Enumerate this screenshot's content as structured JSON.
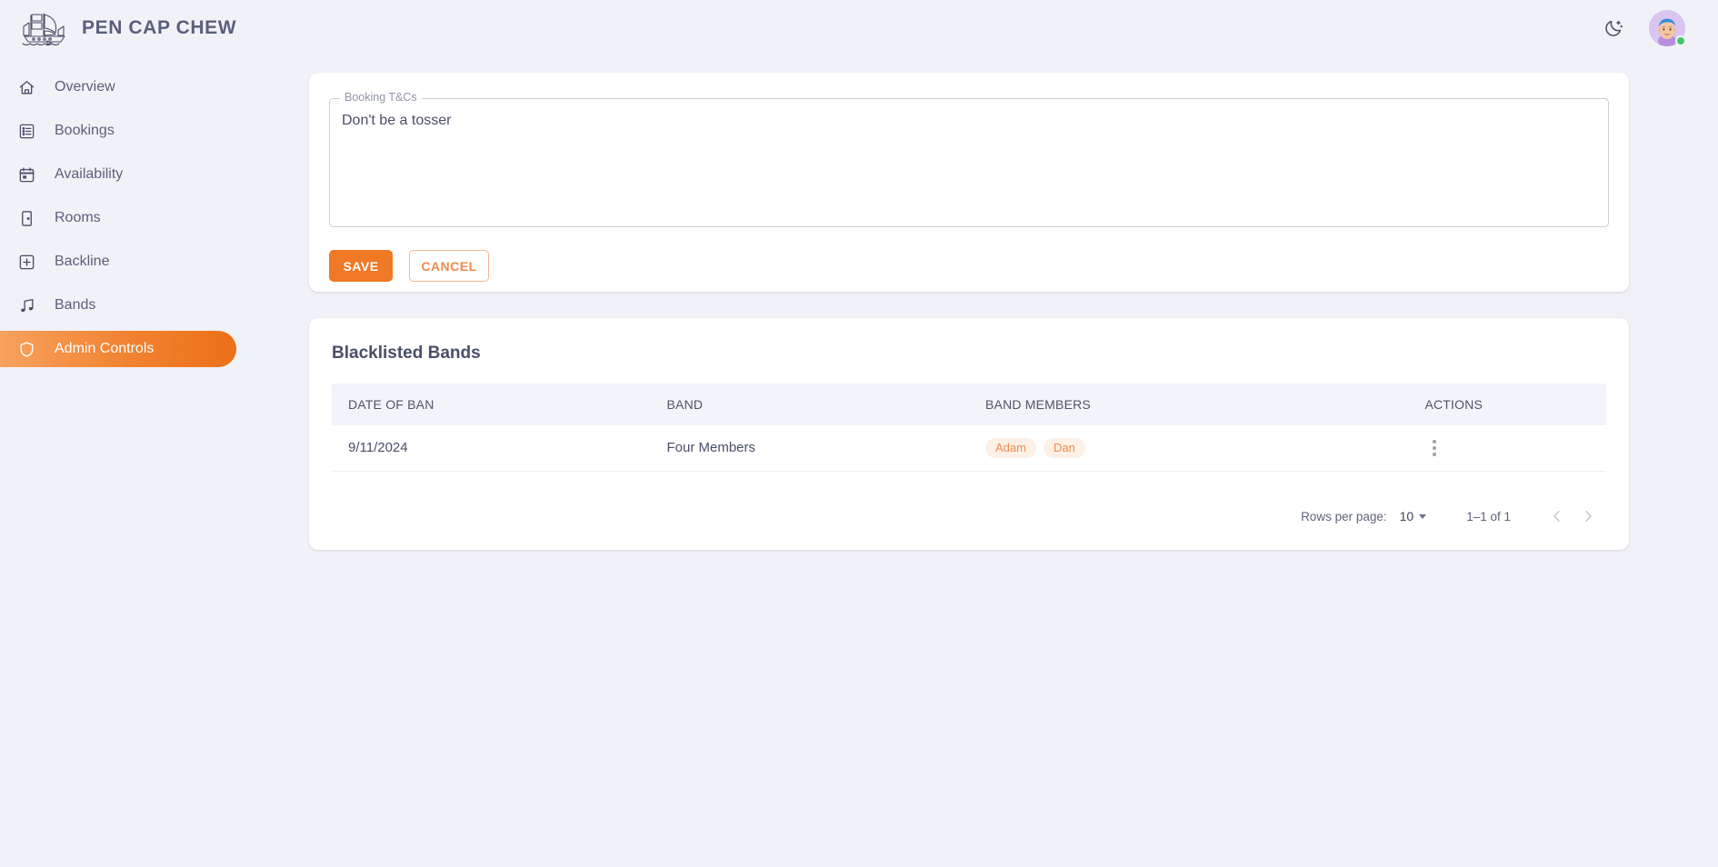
{
  "header": {
    "brand_title": "PEN CAP CHEW",
    "logo_icon": "ship-logo-icon",
    "dark_mode_icon": "moon-stars-icon",
    "avatar_icon": "user-avatar",
    "status_icon": "online-status-dot"
  },
  "sidebar": {
    "items": [
      {
        "label": "Overview",
        "icon": "home-icon",
        "active": false
      },
      {
        "label": "Bookings",
        "icon": "list-icon",
        "active": false
      },
      {
        "label": "Availability",
        "icon": "calendar-icon",
        "active": false
      },
      {
        "label": "Rooms",
        "icon": "door-icon",
        "active": false
      },
      {
        "label": "Backline",
        "icon": "plus-square-icon",
        "active": false
      },
      {
        "label": "Bands",
        "icon": "music-note-icon",
        "active": false
      },
      {
        "label": "Admin Controls",
        "icon": "shield-icon",
        "active": true
      }
    ]
  },
  "terms_card": {
    "field_legend": "Booking T&Cs",
    "field_value": "Don't be a tosser",
    "field_placeholder": "Booking T&Cs",
    "save_label": "SAVE",
    "cancel_label": "CANCEL"
  },
  "table_card": {
    "title": "Blacklisted Bands",
    "columns": [
      "DATE OF BAN",
      "BAND",
      "BAND MEMBERS",
      "ACTIONS"
    ],
    "rows": [
      {
        "date_of_ban": "9/11/2024",
        "band": "Four Members",
        "members": [
          "Adam",
          "Dan"
        ],
        "actions_icon": "more-vertical-icon"
      }
    ],
    "pagination": {
      "rows_per_page_label": "Rows per page:",
      "rows_per_page_value": "10",
      "range": "1–1 of 1",
      "prev_icon": "chevron-left-icon",
      "next_icon": "chevron-right-icon"
    }
  },
  "colors": {
    "accent": "#ef7924",
    "accent_light": "#f7a25f",
    "page_bg": "#f1f2f7",
    "card_bg": "#ffffff",
    "text": "#4a4f68",
    "chip_bg": "#fdf0e6",
    "chip_text": "#ef8c4d",
    "status_online": "#44c767"
  }
}
